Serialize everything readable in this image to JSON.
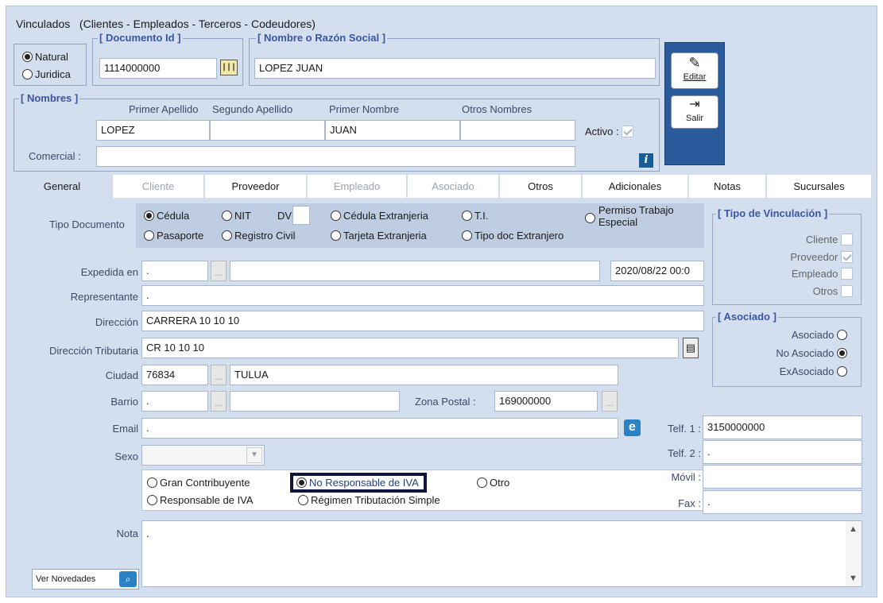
{
  "window": {
    "title": "Vinculados",
    "subtitle": "(Clientes - Empleados - Terceros - Codeudores)"
  },
  "person_type": {
    "natural": "Natural",
    "juridica": "Juridica",
    "selected": "natural"
  },
  "documento": {
    "legend": "[ Documento Id ]",
    "value": "1114000000",
    "barcode_icon": "barcode-icon"
  },
  "nombre": {
    "legend": "[ Nombre o Razón Social ]",
    "value": "LOPEZ JUAN"
  },
  "nombres": {
    "legend": "[ Nombres ]",
    "primer_apellido_label": "Primer Apellido",
    "segundo_apellido_label": "Segundo Apellido",
    "primer_nombre_label": "Primer Nombre",
    "otros_nombres_label": "Otros Nombres",
    "primer_apellido": "LOPEZ",
    "segundo_apellido": "",
    "primer_nombre": "JUAN",
    "otros_nombres": "",
    "activo_label": "Activo :",
    "comercial_label": "Comercial :",
    "comercial": "",
    "info_icon": "i"
  },
  "buttons": {
    "editar": "Editar",
    "salir": "Salir"
  },
  "tabs": [
    "General",
    "Cliente",
    "Proveedor",
    "Empleado",
    "Asociado",
    "Otros",
    "Adicionales",
    "Notas",
    "Sucursales"
  ],
  "tipo_documento": {
    "label": "Tipo Documento",
    "cedula": "Cédula",
    "nit": "NIT",
    "dv": "DV",
    "cedula_ext": "Cédula Extranjeria",
    "ti": "T.I.",
    "permiso_1": "Permiso Trabajo",
    "permiso_2": "Especial",
    "pasaporte": "Pasaporte",
    "registro_civil": "Registro Civil",
    "tarjeta_ext": "Tarjeta Extranjeria",
    "tipo_doc_ext": "Tipo doc Extranjero"
  },
  "fields": {
    "expedida_label": "Expedida en",
    "expedida": ".",
    "fecha": "2020/08/22 00:0",
    "representante_label": "Representante",
    "representante": ".",
    "direccion_label": "Dirección",
    "direccion": "CARRERA 10 10 10",
    "dir_trib_label": "Dirección Tributaria",
    "dir_trib": "CR 10 10 10",
    "ciudad_label": "Ciudad",
    "ciudad_code": "76834",
    "ciudad_name": "TULUA",
    "barrio_label": "Barrio",
    "barrio": ".",
    "zona_label": "Zona Postal :",
    "zona": "169000000",
    "email_label": "Email",
    "email": ".",
    "sexo_label": "Sexo",
    "nota_label": "Nota",
    "nota": ".",
    "ver_novedades": "Ver Novedades"
  },
  "telefonos": {
    "telf1_label": "Telf. 1 :",
    "telf1": "3150000000",
    "telf2_label": "Telf. 2 :",
    "telf2": ".",
    "movil_label": "Móvil :",
    "movil": "",
    "fax_label": "Fax :",
    "fax": "."
  },
  "regimen": {
    "gran": "Gran Contribuyente",
    "no_resp": "No Responsable de IVA",
    "otro": "Otro",
    "resp": "Responsable de IVA",
    "simple": "Régimen Tributación Simple"
  },
  "tipo_vinculacion": {
    "legend": "[ Tipo de Vinculación ]",
    "cliente": "Cliente",
    "proveedor": "Proveedor",
    "empleado": "Empleado",
    "otros": "Otros"
  },
  "asociado": {
    "legend": "[ Asociado ]",
    "asociado": "Asociado",
    "no_asociado": "No Asociado",
    "exasociado": "ExAsociado"
  }
}
